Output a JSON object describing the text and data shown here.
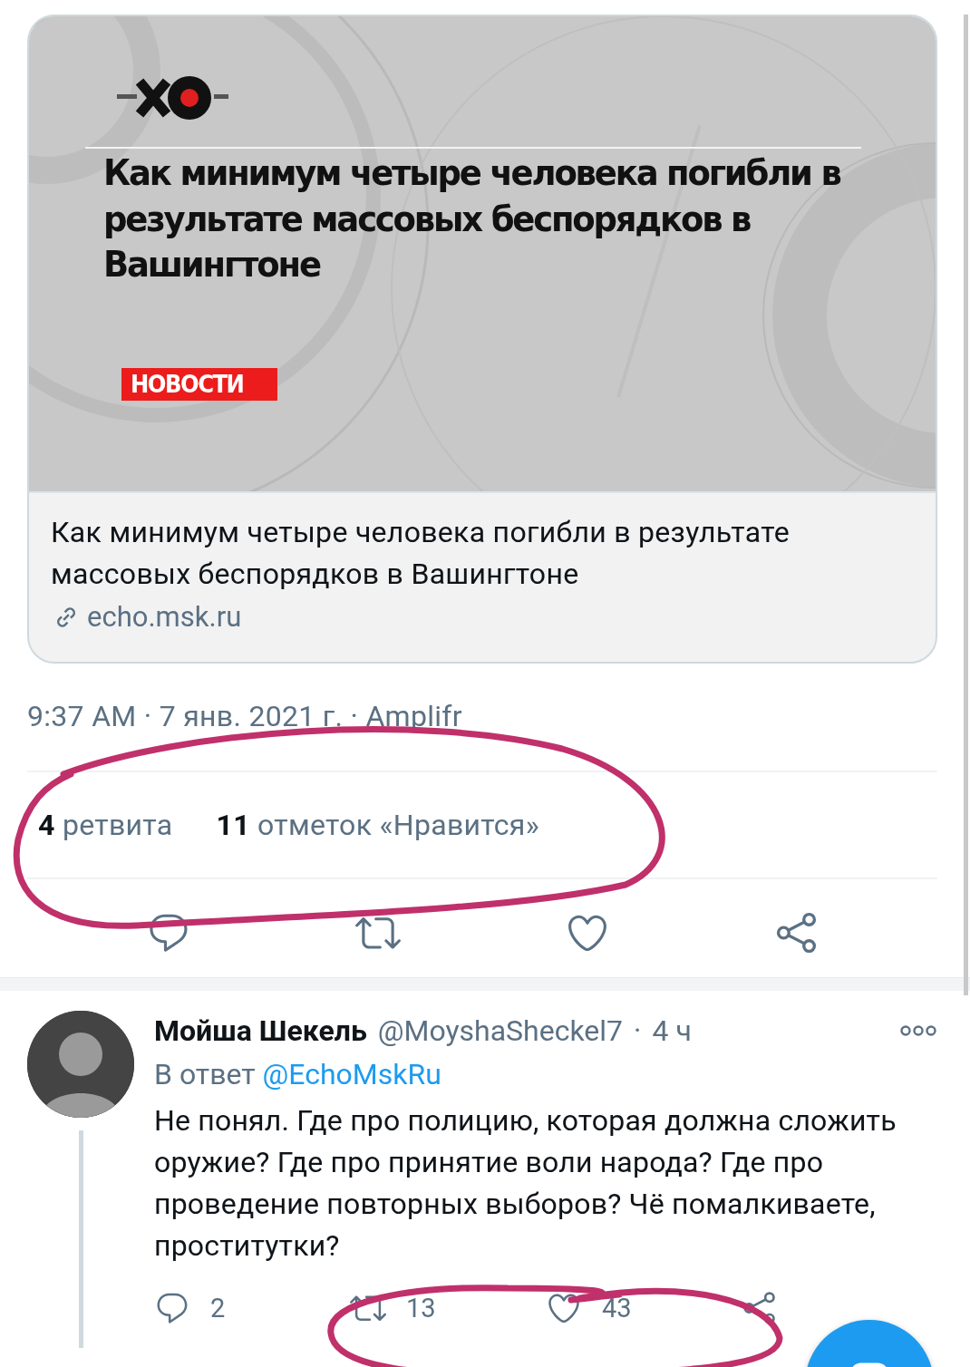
{
  "link_card": {
    "image": {
      "headline": "Как минимум четыре человека погибли в результате массовых беспорядков в Вашингтоне",
      "badge": "НОВОСТИ"
    },
    "title": "Как минимум четыре человека погибли в результате массовых беспорядков в Вашингтоне",
    "domain": "echo.msk.ru"
  },
  "timestamp": "9:37 AM · 7 янв. 2021 г. · Amplifr",
  "stats": [
    {
      "count": "4",
      "label": "ретвита"
    },
    {
      "count": "11",
      "label": "отметок «Нравится»"
    }
  ],
  "actions": [
    {
      "kind": "reply"
    },
    {
      "kind": "retweet"
    },
    {
      "kind": "like"
    },
    {
      "kind": "share"
    }
  ],
  "reply": {
    "name": "Мойша Шекель",
    "handle": "@MoyshaSheckel7",
    "separator": "·",
    "time": "4 ч",
    "reply_prefix": "В ответ",
    "reply_to": "@EchoMskRu",
    "text": "Не понял. Где про полицию, которая должна сложить оружие? Где про принятие воли народа? Где про проведение повторных выборов? Чё помалкиваете, проститутки?",
    "actions": [
      {
        "kind": "reply",
        "count": "2"
      },
      {
        "kind": "retweet",
        "count": "13"
      },
      {
        "kind": "like",
        "count": "43"
      },
      {
        "kind": "share"
      }
    ]
  }
}
